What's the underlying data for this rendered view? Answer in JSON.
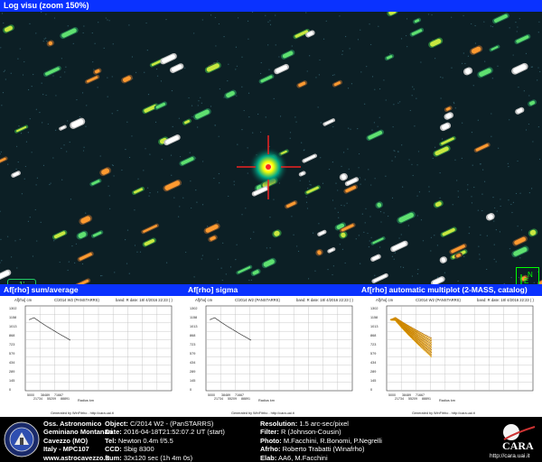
{
  "top_title": "Log visu (zoom 150%)",
  "image_overlay": {
    "scale_label": "1'",
    "north_label": "N",
    "east_label": "E"
  },
  "panels": {
    "p1_title": "Af[rho] sum/average",
    "p2_title": "Af[rho] sigma",
    "p3_title": "Af[rho] automatic multiplot (2-MASS, catalog)"
  },
  "plot_header": {
    "object": "C/2014 W2 (PANSTARRS)",
    "band": "band: R date: 18/ 4/2016 22:23 ( )"
  },
  "plot_ylabel": "Af[rho] cm",
  "plot_xlabel": "Radius km",
  "plot_footer": "Generated by WinFitrho - http://cara.uai.it",
  "y_ticks": [
    "1302",
    "1158",
    "1013",
    "868",
    "723",
    "579",
    "434",
    "289",
    "145",
    "0"
  ],
  "x_ticks_top": [
    "5000",
    "38489",
    "71667"
  ],
  "x_ticks_bottom": [
    "21734",
    "55209",
    "88891"
  ],
  "footer": {
    "obs_name": "Oss. Astronomico",
    "obs_name2": "Geminiano Montanari",
    "obs_city": "Cavezzo (MO)",
    "obs_country": "Italy - MPC107",
    "obs_url": "www.astrocavezzo.it",
    "object_label": "Object:",
    "object_value": "C/2014 W2 - (PanSTARRS)",
    "date_label": "Date:",
    "date_value": "2016-04-18T21:52:07.2 UT (start)",
    "tel_label": "Tel:",
    "tel_value": "Newton 0.4m f/5.5",
    "ccd_label": "CCD:",
    "ccd_value": "Sbig 8300",
    "sum_label": "Sum:",
    "sum_value": "32x120 sec (1h 4m 0s)",
    "res_label": "Resolution:",
    "res_value": "1.5 arc-sec/pixel",
    "filter_label": "Filter:",
    "filter_value": "R (Johnson-Cousin)",
    "photo_label": "Photo:",
    "photo_value": "M.Facchini, R.Bonomi, P.Negrelli",
    "afrho_label": "Afrho:",
    "afrho_value": "Roberto Trabatti (Winafrho)",
    "elab_label": "Elab:",
    "elab_value": "AA6, M.Facchini",
    "cara_title": "CARA",
    "cara_url": "http://cara.uai.it"
  }
}
